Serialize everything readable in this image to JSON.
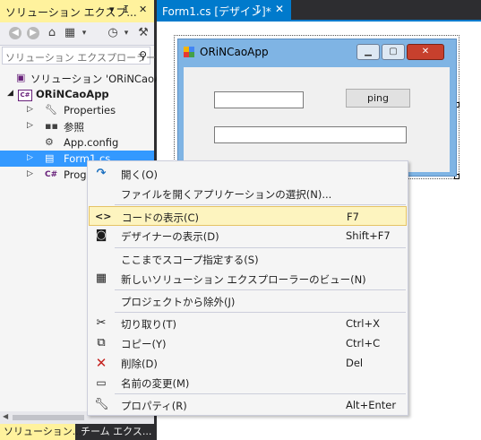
{
  "solution_explorer": {
    "title": "ソリューション エクスプ...",
    "title_glyph_dropdown": "▾",
    "title_glyph_pin": "ⵊ",
    "title_glyph_close": "✕",
    "search_placeholder": "ソリューション エクスプローラー",
    "toolbar_icons": [
      "back-icon",
      "forward-icon",
      "home-icon",
      "switch-view-icon",
      "history-icon",
      "settings-icon"
    ],
    "tree": [
      {
        "label": "ソリューション 'ORiNCaoApp",
        "expand": "",
        "icon": "solution-icon"
      },
      {
        "label": "ORiNCaoApp",
        "expand": "◢",
        "icon": "csharp-project-icon"
      },
      {
        "label": "Properties",
        "expand": "▷",
        "icon": "wrench-icon"
      },
      {
        "label": "参照",
        "expand": "▷",
        "icon": "references-icon"
      },
      {
        "label": "App.config",
        "expand": "",
        "icon": "config-icon"
      },
      {
        "label": "Form1.cs",
        "expand": "▷",
        "icon": "form-icon"
      },
      {
        "label": "Prog",
        "expand": "▷",
        "icon": "csharp-file-icon"
      }
    ],
    "bottom_tabs": [
      "ソリューション...",
      "チーム エクス..."
    ]
  },
  "document_tab": {
    "label": "Form1.cs [デザイン]*",
    "pin_glyph": "ⵊ",
    "close_glyph": "✕"
  },
  "form": {
    "title": "ORiNCaoApp",
    "ping_button": "ping",
    "min_glyph": "▁",
    "max_glyph": "▢",
    "close_glyph": "✕"
  },
  "context_menu": {
    "items": [
      {
        "label": "開く(O)",
        "shortcut": "",
        "icon": "open-icon",
        "highlighted": false
      },
      {
        "label": "ファイルを開くアプリケーションの選択(N)...",
        "shortcut": "",
        "icon": "",
        "highlighted": false
      },
      {
        "label": "コードの表示(C)",
        "shortcut": "F7",
        "icon": "view-code-icon",
        "highlighted": true
      },
      {
        "label": "デザイナーの表示(D)",
        "shortcut": "Shift+F7",
        "icon": "view-designer-icon",
        "highlighted": false
      },
      {
        "label": "ここまでスコープ指定する(S)",
        "shortcut": "",
        "icon": "",
        "highlighted": false
      },
      {
        "label": "新しいソリューション エクスプローラーのビュー(N)",
        "shortcut": "",
        "icon": "new-view-icon",
        "highlighted": false
      },
      {
        "label": "プロジェクトから除外(J)",
        "shortcut": "",
        "icon": "",
        "highlighted": false
      },
      {
        "label": "切り取り(T)",
        "shortcut": "Ctrl+X",
        "icon": "cut-icon",
        "highlighted": false
      },
      {
        "label": "コピー(Y)",
        "shortcut": "Ctrl+C",
        "icon": "copy-icon",
        "highlighted": false
      },
      {
        "label": "削除(D)",
        "shortcut": "Del",
        "icon": "delete-icon",
        "highlighted": false
      },
      {
        "label": "名前の変更(M)",
        "shortcut": "",
        "icon": "rename-icon",
        "highlighted": false
      },
      {
        "label": "プロパティ(R)",
        "shortcut": "Alt+Enter",
        "icon": "properties-wrench-icon",
        "highlighted": false
      }
    ]
  },
  "colors": {
    "title_highlight": "#fff29d",
    "selection": "#3399ff",
    "accent_tab": "#007acc",
    "menu_highlight": "#fdf4bf",
    "form_frame": "#7fb4e4"
  }
}
